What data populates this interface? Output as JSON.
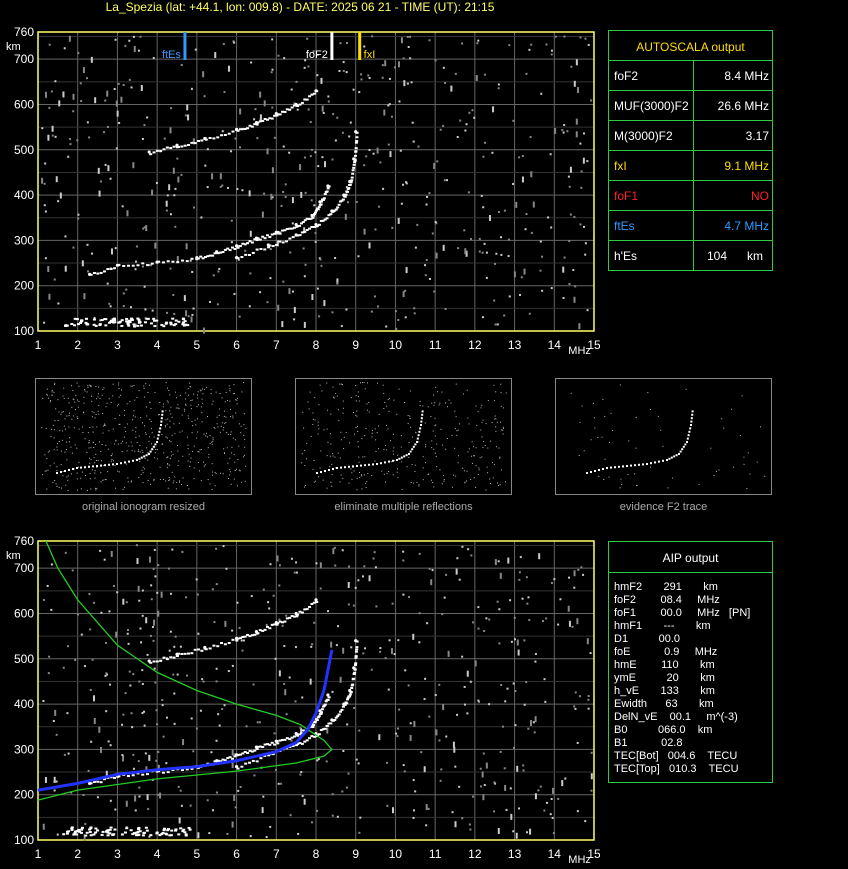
{
  "header": {
    "title": "La_Spezia (lat: +44.1, lon: 009.8) - DATE: 2025 06 21 - TIME (UT): 21:15"
  },
  "chart_data": [
    {
      "type": "scatter",
      "title": "",
      "xlabel": "MHz",
      "ylabel": "km",
      "xlim": [
        1,
        15
      ],
      "ylim": [
        100,
        760
      ],
      "x_ticks": [
        1,
        2,
        3,
        4,
        5,
        6,
        7,
        8,
        9,
        10,
        11,
        12,
        13,
        14,
        15
      ],
      "y_ticks": [
        100,
        200,
        300,
        400,
        500,
        600,
        700,
        760
      ],
      "grid": true,
      "series": [
        {
          "name": "",
          "color": "#ffffff",
          "x": [
            2.3,
            3.0,
            4.0,
            5.0,
            5.5,
            6.0,
            6.5,
            7.0,
            7.5,
            7.9,
            8.1,
            8.3
          ],
          "y": [
            225,
            245,
            252,
            262,
            275,
            288,
            305,
            318,
            335,
            355,
            385,
            420
          ]
        },
        {
          "name": "",
          "color": "#ffffff",
          "x": [
            6.0,
            6.8,
            7.5,
            8.0,
            8.4,
            8.7,
            8.85,
            8.95,
            9.0
          ],
          "y": [
            262,
            290,
            312,
            335,
            365,
            400,
            430,
            480,
            540
          ]
        },
        {
          "name": "",
          "color": "#ffffff",
          "x": [
            3.8,
            4.5,
            5.2,
            6.0,
            6.5,
            7.0,
            7.5,
            8.0
          ],
          "y": [
            495,
            510,
            525,
            545,
            560,
            580,
            600,
            630
          ]
        }
      ],
      "markers": [
        {
          "label": "ftEs",
          "x": 4.7,
          "color": "#3399ff"
        },
        {
          "label": "foF2",
          "x": 8.4,
          "color": "#ffffff"
        },
        {
          "label": "fxI",
          "x": 9.1,
          "color": "#ffdd00"
        }
      ]
    },
    {
      "type": "line",
      "title": "",
      "xlabel": "MHz",
      "ylabel": "km",
      "xlim": [
        1,
        15
      ],
      "ylim": [
        100,
        760
      ],
      "grid": true,
      "series": [
        {
          "name": "",
          "color": "#22cc22",
          "x": [
            1.2,
            1.5,
            2.0,
            3.0,
            4.0,
            5.0,
            6.0,
            7.0,
            7.6,
            8.2,
            8.4,
            8.2,
            7.5,
            6.0,
            4.0,
            2.0,
            1.0
          ],
          "y": [
            760,
            700,
            630,
            530,
            470,
            430,
            400,
            375,
            355,
            320,
            300,
            285,
            270,
            252,
            235,
            210,
            188
          ]
        },
        {
          "name": "",
          "color": "#2233ff",
          "x": [
            1.0,
            2.0,
            3.0,
            4.0,
            5.0,
            6.0,
            7.0,
            7.5,
            7.8,
            8.0,
            8.2,
            8.4
          ],
          "y": [
            210,
            225,
            245,
            255,
            262,
            275,
            295,
            315,
            345,
            380,
            430,
            520
          ]
        }
      ]
    }
  ],
  "autoscala": {
    "heading": "AUTOSCALA output",
    "rows": [
      {
        "label": "foF2",
        "value": "8.4 MHz",
        "color": "#ffffff"
      },
      {
        "label": "MUF(3000)F2",
        "value": "26.6 MHz",
        "color": "#ffffff"
      },
      {
        "label": "M(3000)F2",
        "value": "3.17",
        "color": "#ffffff"
      },
      {
        "label": "fxI",
        "value": "9.1 MHz",
        "color": "#ffdd00"
      },
      {
        "label": "foF1",
        "value": "NO",
        "color": "#ff2222"
      },
      {
        "label": "ftEs",
        "value": "4.7 MHz",
        "color": "#3399ff"
      },
      {
        "label": "h'Es",
        "value": "104      km",
        "color": "#ffffff"
      }
    ]
  },
  "thumbnails": [
    {
      "caption": "original ionogram resized"
    },
    {
      "caption": "eliminate multiple reflections"
    },
    {
      "caption": "evidence F2 trace"
    }
  ],
  "aip": {
    "heading": "AIP output",
    "lines": [
      "hmF2       291       km",
      "foF2        08.4     MHz",
      "foF1        00.0     MHz   [PN]",
      "hmF1       ---       km",
      "D1          00.0",
      "foE           0.9     MHz",
      "hmE        110       km",
      "ymE          20       km",
      "h_vE       133       km",
      "Ewidth      63       km",
      "DelN_vE    00.1     m^(-3)",
      "B0          066.0    km",
      "B1           02.8",
      "TEC[Bot]   004.6    TECU",
      "TEC[Top]   010.3    TECU"
    ]
  }
}
